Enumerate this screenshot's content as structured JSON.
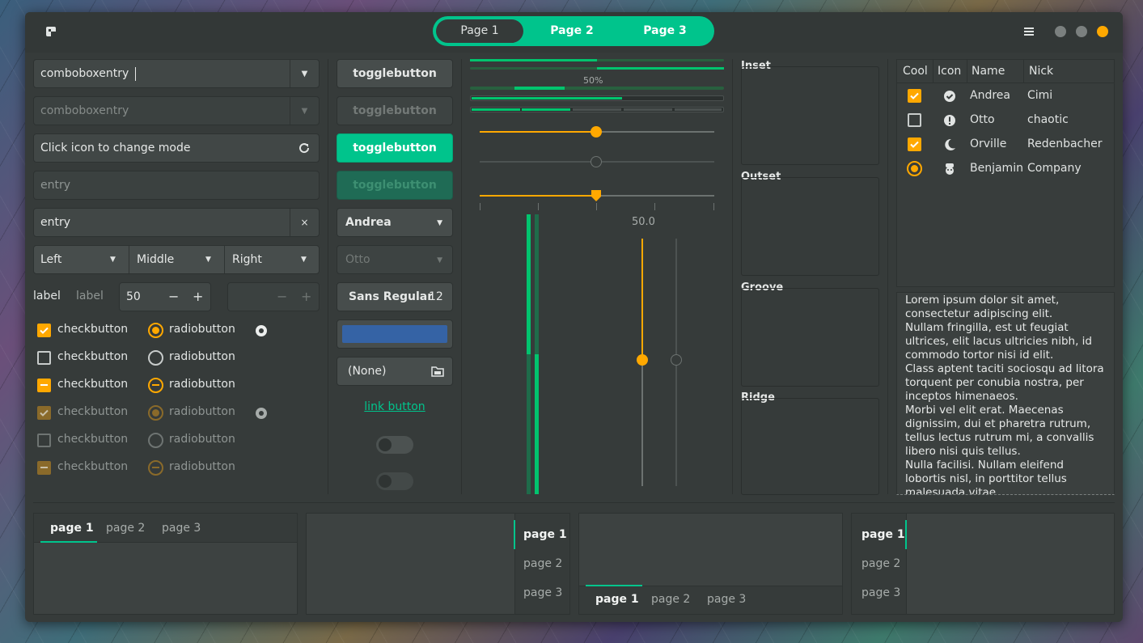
{
  "header": {
    "stack_pages": [
      "Page 1",
      "Page 2",
      "Page 3"
    ],
    "menu_icon": "hamburger-icon"
  },
  "col1": {
    "combo1": "comboboxentry",
    "combo2": "comboboxentry",
    "entry_mode": "Click icon to change mode",
    "entry_placeholder": "entry",
    "entry_value": "entry",
    "combos": [
      "Left",
      "Middle",
      "Right"
    ],
    "label1": "label",
    "label2": "label",
    "spin_value": "50",
    "spin_minus": "−",
    "spin_plus": "+",
    "checks": [
      "checkbutton",
      "checkbutton",
      "checkbutton",
      "checkbutton",
      "checkbutton",
      "checkbutton"
    ],
    "radios": [
      "radiobutton",
      "radiobutton",
      "radiobutton",
      "radiobutton",
      "radiobutton",
      "radiobutton"
    ]
  },
  "col2": {
    "toggles": [
      "togglebutton",
      "togglebutton",
      "togglebutton",
      "togglebutton"
    ],
    "combo_andrea": "Andrea",
    "combo_otto": "Otto",
    "font_name": "Sans Regular",
    "font_size": "12",
    "color": "#3563a5",
    "file": "(None)",
    "link": "link button"
  },
  "col3": {
    "progress_label": "50%",
    "scale_value": "50.0",
    "slider_levels": [
      0.5,
      0.5,
      0.5
    ],
    "accent": "#ffa800",
    "green": "#00c46e"
  },
  "frames": [
    "Inset",
    "Outset",
    "Groove",
    "Ridge"
  ],
  "tree": {
    "columns": [
      "Cool",
      "Icon",
      "Name",
      "Nick"
    ],
    "rows": [
      {
        "name": "Andrea",
        "nick": "Cimi",
        "icon": "check-circle-icon"
      },
      {
        "name": "Otto",
        "nick": "chaotic",
        "icon": "exclamation-icon"
      },
      {
        "name": "Orville",
        "nick": "Redenbacher",
        "icon": "moon-icon"
      },
      {
        "name": "Benjamin",
        "nick": "Company",
        "icon": "face-icon"
      }
    ]
  },
  "text": [
    "Lorem ipsum dolor sit amet,",
    "consectetur adipiscing elit.",
    "Nullam fringilla, est ut feugiat",
    "ultrices, elit lacus ultricies nibh, id",
    "commodo tortor nisi id elit.",
    "Class aptent taciti sociosqu ad litora",
    "torquent per conubia nostra, per",
    "inceptos himenaeos.",
    "Morbi vel elit erat. Maecenas",
    "dignissim, dui et pharetra rutrum,",
    "tellus lectus rutrum mi, a convallis",
    "libero nisi quis tellus.",
    "Nulla facilisi. Nullam eleifend",
    "lobortis nisl, in porttitor tellus",
    "malesuada vitae."
  ],
  "notebooks": {
    "tabs": [
      "page 1",
      "page 2",
      "page 3"
    ]
  }
}
